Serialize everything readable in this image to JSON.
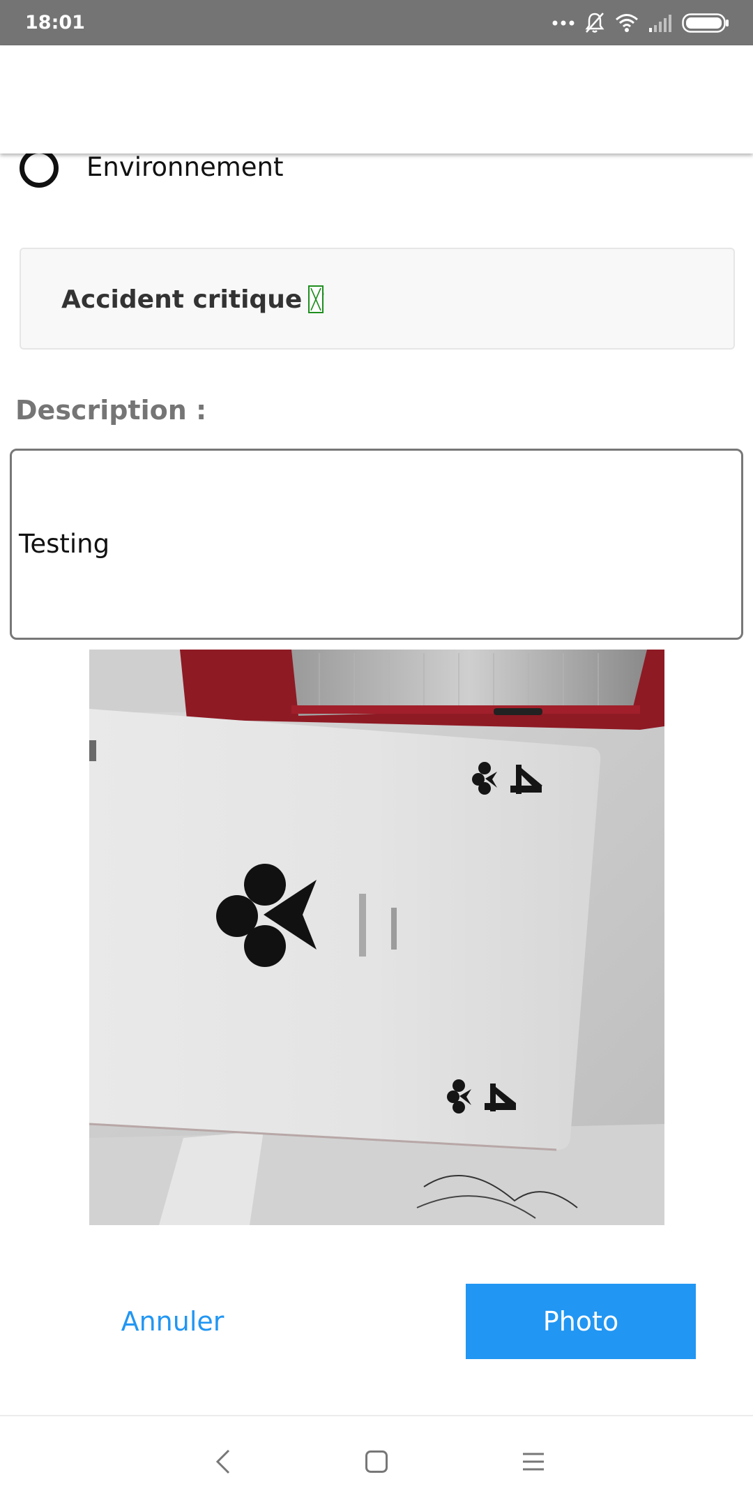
{
  "status_bar": {
    "time": "18:01",
    "icons": [
      "more-dots-icon",
      "bell-off-icon",
      "wifi-icon",
      "signal-icon",
      "battery-icon"
    ]
  },
  "form": {
    "category_option": {
      "label": "Environnement",
      "selected": false
    },
    "critical": {
      "label": "Accident critique ?",
      "checked": false
    },
    "description": {
      "label": "Description :",
      "value": "Testing"
    }
  },
  "photo": {
    "subject": "photo-of-ace-of-clubs-card"
  },
  "actions": {
    "cancel_label": "Annuler",
    "photo_label": "Photo"
  },
  "navigation": {
    "icons": [
      "back-icon",
      "home-icon",
      "recents-icon"
    ]
  },
  "colors": {
    "accent": "#2196f3",
    "status_bar": "#747474",
    "checkbox_border": "#1e8e1e"
  }
}
